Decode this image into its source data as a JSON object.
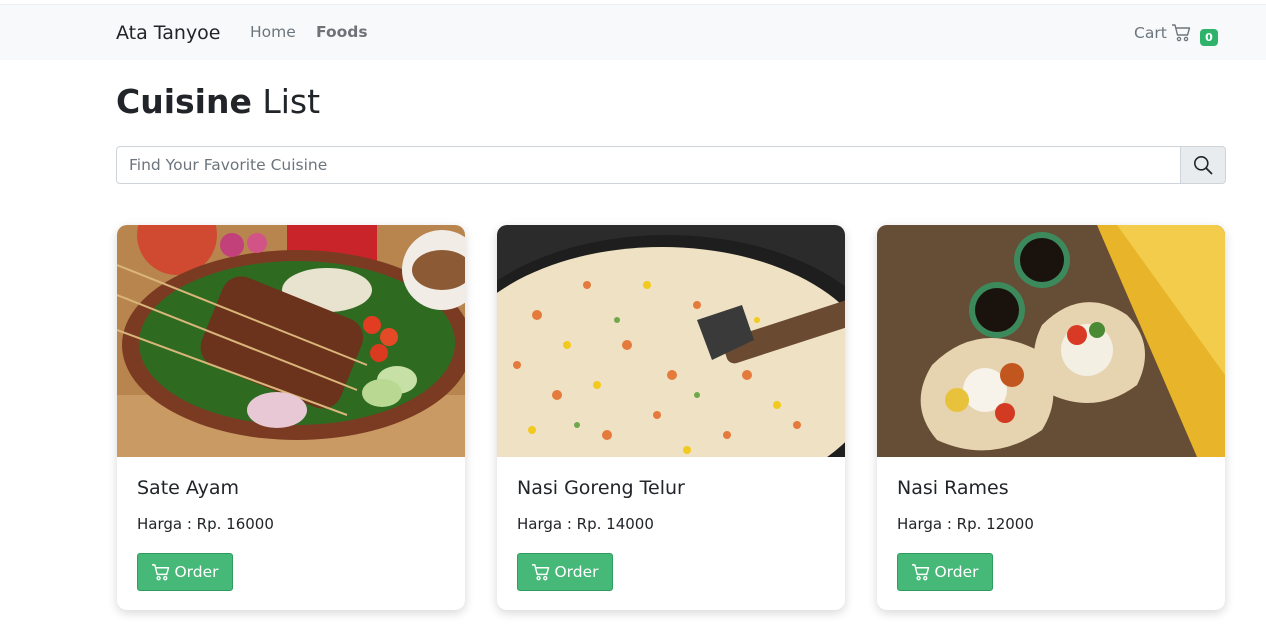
{
  "navbar": {
    "brand": "Ata Tanyoe",
    "links": [
      "Home",
      "Foods"
    ],
    "cart_label": "Cart",
    "cart_count": "0"
  },
  "page": {
    "title_bold": "Cuisine",
    "title_rest": "List"
  },
  "search": {
    "placeholder": "Find Your Favorite Cuisine",
    "value": ""
  },
  "foods": [
    {
      "name": "Sate Ayam",
      "price": "Harga : Rp. 16000",
      "order_label": "Order"
    },
    {
      "name": "Nasi Goreng Telur",
      "price": "Harga : Rp. 14000",
      "order_label": "Order"
    },
    {
      "name": "Nasi Rames",
      "price": "Harga : Rp. 12000",
      "order_label": "Order"
    }
  ],
  "icons": {
    "search": "search-icon",
    "cart": "cart-icon"
  },
  "colors": {
    "accent_green": "#46b877",
    "navbar_bg": "#f8f9fa"
  }
}
